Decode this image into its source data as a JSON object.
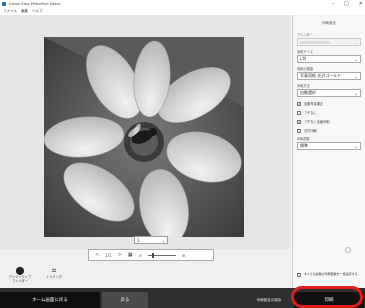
{
  "window": {
    "title": "Canon Easy-PhotoPrint Editor",
    "controls": [
      "–",
      "□",
      "✕"
    ]
  },
  "menu": [
    "ファイル",
    "編集",
    "ヘルプ"
  ],
  "preview": {
    "page_selector": "1",
    "page_nav_text": "1/1"
  },
  "tools": [
    {
      "label": "クリエイティブ\nフィルター",
      "icon": "creative-filter-icon"
    },
    {
      "label": "トリミング",
      "icon": "trim-icon"
    }
  ],
  "panel": {
    "header": "印刷設定",
    "printer_label": "プリンター",
    "paper_size_label": "用紙サイズ",
    "paper_size_value": "L判",
    "paper_type_label": "用紙の種類",
    "paper_type_value": "写真用紙 光沢ゴールド",
    "print_quality_label": "印刷方法",
    "print_quality_value": "自動選択",
    "auto_correct_label": "自動写真補正",
    "auto_correct_checked": true,
    "borderless_label": "フチなし",
    "borderless_checked": false,
    "autosave_label": "フチなし全面印刷",
    "autosave_checked": true,
    "date_label": "日付印刷",
    "date_checked": false,
    "copies_label": "印刷部数",
    "copies_value": "標準",
    "bottom_check_label": "すべての画像の印刷部数を一括指定する",
    "bottom_check_checked": false
  },
  "bottom_bar": {
    "home": "ホーム画面に戻る",
    "back": "戻る",
    "print_settings": "印刷設定の保存",
    "print": "印刷"
  },
  "colors": {
    "bottom_bar": "#2f2f2f",
    "highlight": "#e21b1b"
  }
}
